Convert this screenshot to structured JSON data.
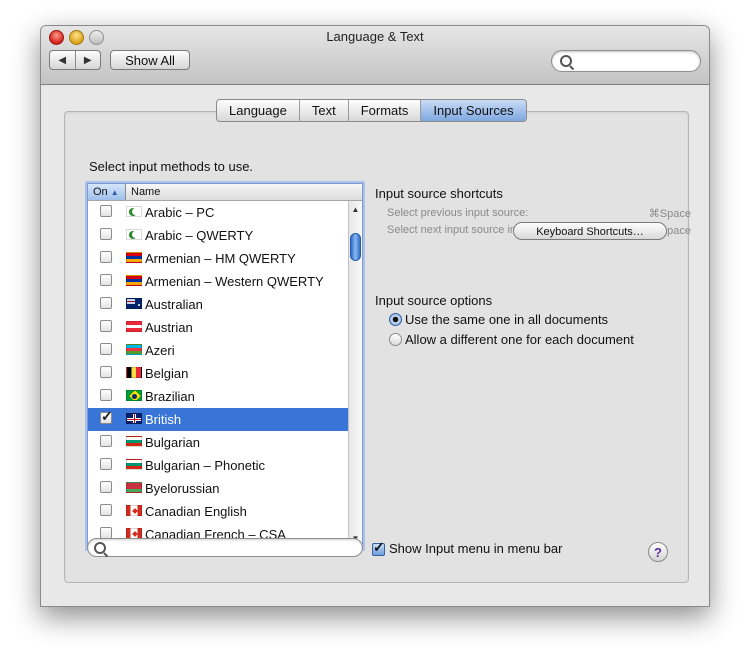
{
  "window": {
    "title": "Language & Text"
  },
  "toolbar": {
    "back_label": "◀",
    "forward_label": "▶",
    "show_all_label": "Show All",
    "search_placeholder": ""
  },
  "tabs": [
    {
      "label": "Language",
      "active": false
    },
    {
      "label": "Text",
      "active": false
    },
    {
      "label": "Formats",
      "active": false
    },
    {
      "label": "Input Sources",
      "active": true
    }
  ],
  "list": {
    "prompt": "Select input methods to use.",
    "col_on": "On",
    "col_name": "Name",
    "sort_indicator": "▲",
    "items": [
      {
        "name": "Arabic – PC",
        "checked": false,
        "flag": "flag-arabic",
        "selected": false
      },
      {
        "name": "Arabic – QWERTY",
        "checked": false,
        "flag": "flag-arabic",
        "selected": false
      },
      {
        "name": "Armenian – HM QWERTY",
        "checked": false,
        "flag": "flag-armenia",
        "selected": false
      },
      {
        "name": "Armenian – Western QWERTY",
        "checked": false,
        "flag": "flag-armenia",
        "selected": false
      },
      {
        "name": "Australian",
        "checked": false,
        "flag": "flag-australia",
        "selected": false
      },
      {
        "name": "Austrian",
        "checked": false,
        "flag": "flag-austria",
        "selected": false
      },
      {
        "name": "Azeri",
        "checked": false,
        "flag": "flag-azerbaijan",
        "selected": false
      },
      {
        "name": "Belgian",
        "checked": false,
        "flag": "flag-belgium",
        "selected": false
      },
      {
        "name": "Brazilian",
        "checked": false,
        "flag": "flag-brazil",
        "selected": false
      },
      {
        "name": "British",
        "checked": true,
        "flag": "flag-uk",
        "selected": true
      },
      {
        "name": "Bulgarian",
        "checked": false,
        "flag": "flag-bulgaria",
        "selected": false
      },
      {
        "name": "Bulgarian – Phonetic",
        "checked": false,
        "flag": "flag-bulgaria",
        "selected": false
      },
      {
        "name": "Byelorussian",
        "checked": false,
        "flag": "flag-belarus",
        "selected": false
      },
      {
        "name": "Canadian English",
        "checked": false,
        "flag": "flag-canada",
        "selected": false
      },
      {
        "name": "Canadian French – CSA",
        "checked": false,
        "flag": "flag-canada-csa",
        "selected": false
      }
    ]
  },
  "shortcuts": {
    "heading": "Input source shortcuts",
    "prev_label": "Select previous input source:",
    "prev_key": "⌘Space",
    "next_label": "Select next input source in menu:",
    "next_key": "⌥⌘Space",
    "button_label": "Keyboard Shortcuts…"
  },
  "options": {
    "heading": "Input source options",
    "same_label": "Use the same one in all documents",
    "diff_label": "Allow a different one for each document",
    "selected": "same"
  },
  "bottom": {
    "search_placeholder": "",
    "show_menu_label": "Show Input menu in menu bar",
    "show_menu_checked": true,
    "help_label": "?"
  },
  "colors": {
    "selection": "#3875d7",
    "accent": "#6c9ee0"
  }
}
